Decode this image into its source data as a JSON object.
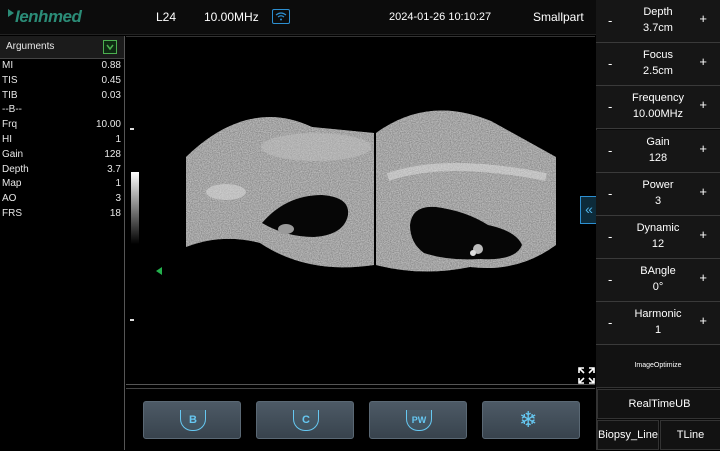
{
  "topbar": {
    "logo": "Ienhmed",
    "probe": "L24",
    "frequency": "10.00MHz",
    "datetime": "2024-01-26 10:10:27",
    "preset": "Smallpart",
    "icons": {
      "wifi": "wifi-icon"
    }
  },
  "arguments": {
    "title": "Arguments",
    "rows": [
      {
        "key": "MI",
        "value": "0.88"
      },
      {
        "key": "TIS",
        "value": "0.45"
      },
      {
        "key": "TIB",
        "value": "0.03"
      },
      {
        "key": "--B--",
        "value": ""
      },
      {
        "key": "Frq",
        "value": "10.00"
      },
      {
        "key": "HI",
        "value": "1"
      },
      {
        "key": "Gain",
        "value": "128"
      },
      {
        "key": "Depth",
        "value": "3.7"
      },
      {
        "key": "Map",
        "value": "1"
      },
      {
        "key": "AO",
        "value": "3"
      },
      {
        "key": "FRS",
        "value": "18"
      }
    ]
  },
  "modes": [
    {
      "label": "B",
      "icon": "b-mode-icon"
    },
    {
      "label": "C",
      "icon": "color-mode-icon"
    },
    {
      "label": "PW",
      "icon": "pw-mode-icon"
    },
    {
      "label": "",
      "icon": "freeze-icon"
    }
  ],
  "params": [
    {
      "name": "Depth",
      "value": "3.7cm"
    },
    {
      "name": "Focus",
      "value": "2.5cm"
    },
    {
      "name": "Frequency",
      "value": "10.00MHz"
    },
    {
      "name": "Gain",
      "value": "128"
    },
    {
      "name": "Power",
      "value": "3"
    },
    {
      "name": "Dynamic",
      "value": "12"
    },
    {
      "name": "BAngle",
      "value": "0°"
    },
    {
      "name": "Harmonic",
      "value": "1"
    }
  ],
  "param_controls": {
    "minus": "-",
    "plus": "+"
  },
  "right_buttons": {
    "optimize": "ImageOptimize",
    "realtime": "RealTimeUB",
    "biopsy": "Biopsy_Line",
    "tline": "TLine",
    "collapse": "«"
  },
  "colors": {
    "accent": "#2d8fd1",
    "mode_icon": "#66c8f2",
    "focus_marker": "#23b14d",
    "brand": "#2b8c77"
  }
}
